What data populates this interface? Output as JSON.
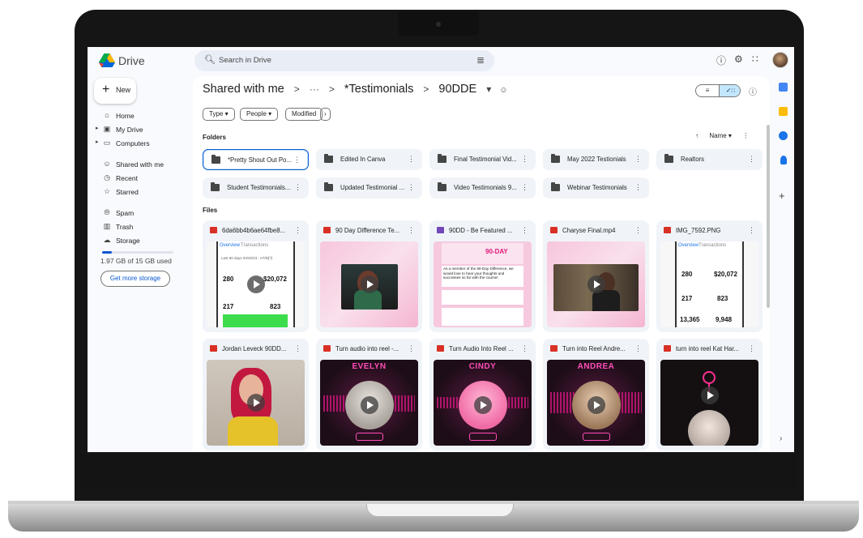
{
  "app": {
    "name": "Drive"
  },
  "search": {
    "placeholder": "Search in Drive"
  },
  "sidebar": {
    "new_label": "New",
    "items": [
      {
        "label": "Home",
        "icon": "home-icon"
      },
      {
        "label": "My Drive",
        "icon": "my-drive-icon"
      },
      {
        "label": "Computers",
        "icon": "computer-icon"
      },
      {
        "label": "Shared with me",
        "icon": "shared-icon"
      },
      {
        "label": "Recent",
        "icon": "clock-icon"
      },
      {
        "label": "Starred",
        "icon": "star-icon"
      },
      {
        "label": "Spam",
        "icon": "spam-icon"
      },
      {
        "label": "Trash",
        "icon": "trash-icon"
      },
      {
        "label": "Storage",
        "icon": "cloud-icon"
      }
    ],
    "storage_text": "1.97 GB of 15 GB used",
    "storage_fraction": 0.131,
    "get_storage": "Get more storage"
  },
  "breadcrumb": {
    "root": "Shared with me",
    "sep": ">",
    "ellipsis": "···",
    "folder": "*Testimonials",
    "current": "90DDE"
  },
  "filters": [
    "Type",
    "People",
    "Modified"
  ],
  "sections": {
    "folders": "Folders",
    "files": "Files"
  },
  "sort_label": "Name",
  "folders": [
    "*Pretty Shout Out Po...",
    "Edited In Canva",
    "Final Testimonial Vid...",
    "May 2022 Testionials",
    "Realtors",
    "Student Testimonials...",
    "Updated Testimonial ...",
    "Video Testimonials 9...",
    "Webinar Testimonials"
  ],
  "files": [
    {
      "name": "6da6bb4b6ae64fbe8...",
      "type": "video"
    },
    {
      "name": "90 Day Difference Te...",
      "type": "video"
    },
    {
      "name": "90DD - Be Featured ...",
      "type": "form"
    },
    {
      "name": "Charyse Final.mp4",
      "type": "video"
    },
    {
      "name": "IMG_7592.PNG",
      "type": "image"
    },
    {
      "name": "Jordan Leveck 90DD...",
      "type": "video"
    },
    {
      "name": "Turn audio into reel -...",
      "type": "video"
    },
    {
      "name": "Turn Audio Into Reel ...",
      "type": "video"
    },
    {
      "name": "Turn into Reel Andre...",
      "type": "video"
    },
    {
      "name": "turn into reel Kat Har...",
      "type": "video"
    }
  ],
  "thumbs": {
    "stats_tabs": [
      "Overview",
      "Transactions"
    ],
    "stats_range": "Last 90 days  03/30/23 - 07/8/[?]",
    "stat_280": "280",
    "stat_20072": "$20,072",
    "stat_217": "217",
    "stat_823": "823",
    "stat_13365": "13,365",
    "stat_9948": "9,948",
    "form_badge": "90-DAY",
    "form_text": "As a member of the 90-Day Difference, we would love to hear your thoughts and successes so far with the course!",
    "reel_names": [
      "EVELYN",
      "CINDY",
      "ANDREA"
    ]
  },
  "colors": {
    "accent": "#0b57d0",
    "selected_bg": "#c2e7ff",
    "video_red": "#d93025",
    "form_purple": "#7248b9",
    "reel_pink": "#ff4db8"
  }
}
